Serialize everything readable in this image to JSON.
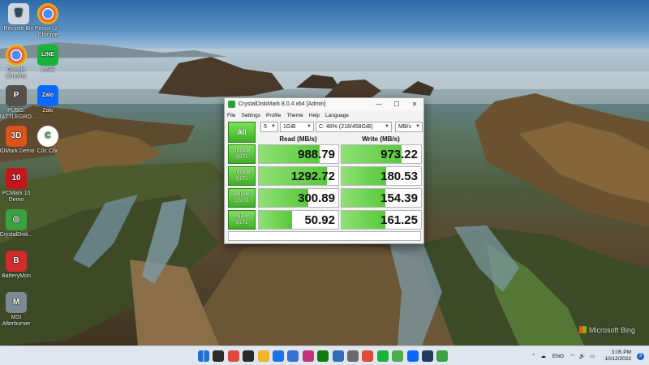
{
  "desktop": {
    "icons": [
      {
        "label": "Recycle Bin",
        "color": "#cfd8e0",
        "glyph": "🗑"
      },
      {
        "label": "Person 2 - Chrome",
        "color": "#e04a3a",
        "glyph": "●"
      },
      {
        "label": "Google Chrome",
        "color": "#e04a3a",
        "glyph": "●"
      },
      {
        "label": "LINE",
        "color": "#19b23b",
        "glyph": "LINE"
      },
      {
        "label": "PUBG: BATTLEGRO...",
        "color": "#55514a",
        "glyph": "P"
      },
      {
        "label": "Zalo",
        "color": "#0a68ff",
        "glyph": "Zalo"
      },
      {
        "label": "3DMark Demo",
        "color": "#d9541b",
        "glyph": "3D"
      },
      {
        "label": "Cốc Cốc",
        "color": "#4cae4c",
        "glyph": "C"
      },
      {
        "label": "PCMark 10 Demo",
        "color": "#c4161c",
        "glyph": "10"
      },
      {
        "label": "CrystalDisk...",
        "color": "#3aa23f",
        "glyph": "◎"
      },
      {
        "label": "BatteryMon",
        "color": "#d12c2c",
        "glyph": "B"
      },
      {
        "label": "MSI Afterburner",
        "color": "#7b8a93",
        "glyph": "M"
      }
    ],
    "watermark": "Microsoft Bing"
  },
  "window": {
    "title": "CrystalDiskMark 8.0.4 x64 [Admin]",
    "buttons": {
      "minimize": "—",
      "maximize": "☐",
      "close": "✕"
    },
    "menu": [
      "File",
      "Settings",
      "Profile",
      "Theme",
      "Help",
      "Language"
    ],
    "all_label": "All",
    "count": "5",
    "size": "1GiB",
    "drive": "C: 48% (218/458GiB)",
    "unit": "MB/s",
    "headers": {
      "read": "Read (MB/s)",
      "write": "Write (MB/s)"
    },
    "rows": [
      {
        "l1": "SEQ1M",
        "l2": "Q8T1",
        "read": "988.79",
        "write": "973.22",
        "read_fill": 0.77,
        "write_fill": 0.76
      },
      {
        "l1": "SEQ1M",
        "l2": "Q1T1",
        "read": "1292.72",
        "write": "180.53",
        "read_fill": 0.86,
        "write_fill": 0.56
      },
      {
        "l1": "RND4K",
        "l2": "Q32T1",
        "read": "300.89",
        "write": "154.39",
        "read_fill": 0.62,
        "write_fill": 0.55
      },
      {
        "l1": "RND4K",
        "l2": "Q1T1",
        "read": "50.92",
        "write": "161.25",
        "read_fill": 0.42,
        "write_fill": 0.55
      }
    ]
  },
  "taskbar": {
    "apps": [
      {
        "name": "start",
        "color": "#1f6fd6"
      },
      {
        "name": "search",
        "color": "#2b2b2b"
      },
      {
        "name": "chrome",
        "color": "#e04a3a"
      },
      {
        "name": "media",
        "color": "#2a2a2a"
      },
      {
        "name": "file-explorer",
        "color": "#f0b429"
      },
      {
        "name": "mail",
        "color": "#1a73e8"
      },
      {
        "name": "store",
        "color": "#3a6fd6"
      },
      {
        "name": "games",
        "color": "#c2337a"
      },
      {
        "name": "xbox",
        "color": "#107c10"
      },
      {
        "name": "photos",
        "color": "#2f6db5"
      },
      {
        "name": "settings",
        "color": "#6b6b6b"
      },
      {
        "name": "chrome-2",
        "color": "#e04a3a"
      },
      {
        "name": "line",
        "color": "#19b23b"
      },
      {
        "name": "coc-coc",
        "color": "#4cae4c"
      },
      {
        "name": "zalo",
        "color": "#0a68ff"
      },
      {
        "name": "terminal",
        "color": "#1e3a5f"
      },
      {
        "name": "crystaldiskmark",
        "color": "#3aa23f"
      }
    ],
    "lang": "ENG",
    "time": "3:05 PM",
    "date": "10/12/2022",
    "notification_count": "3"
  }
}
